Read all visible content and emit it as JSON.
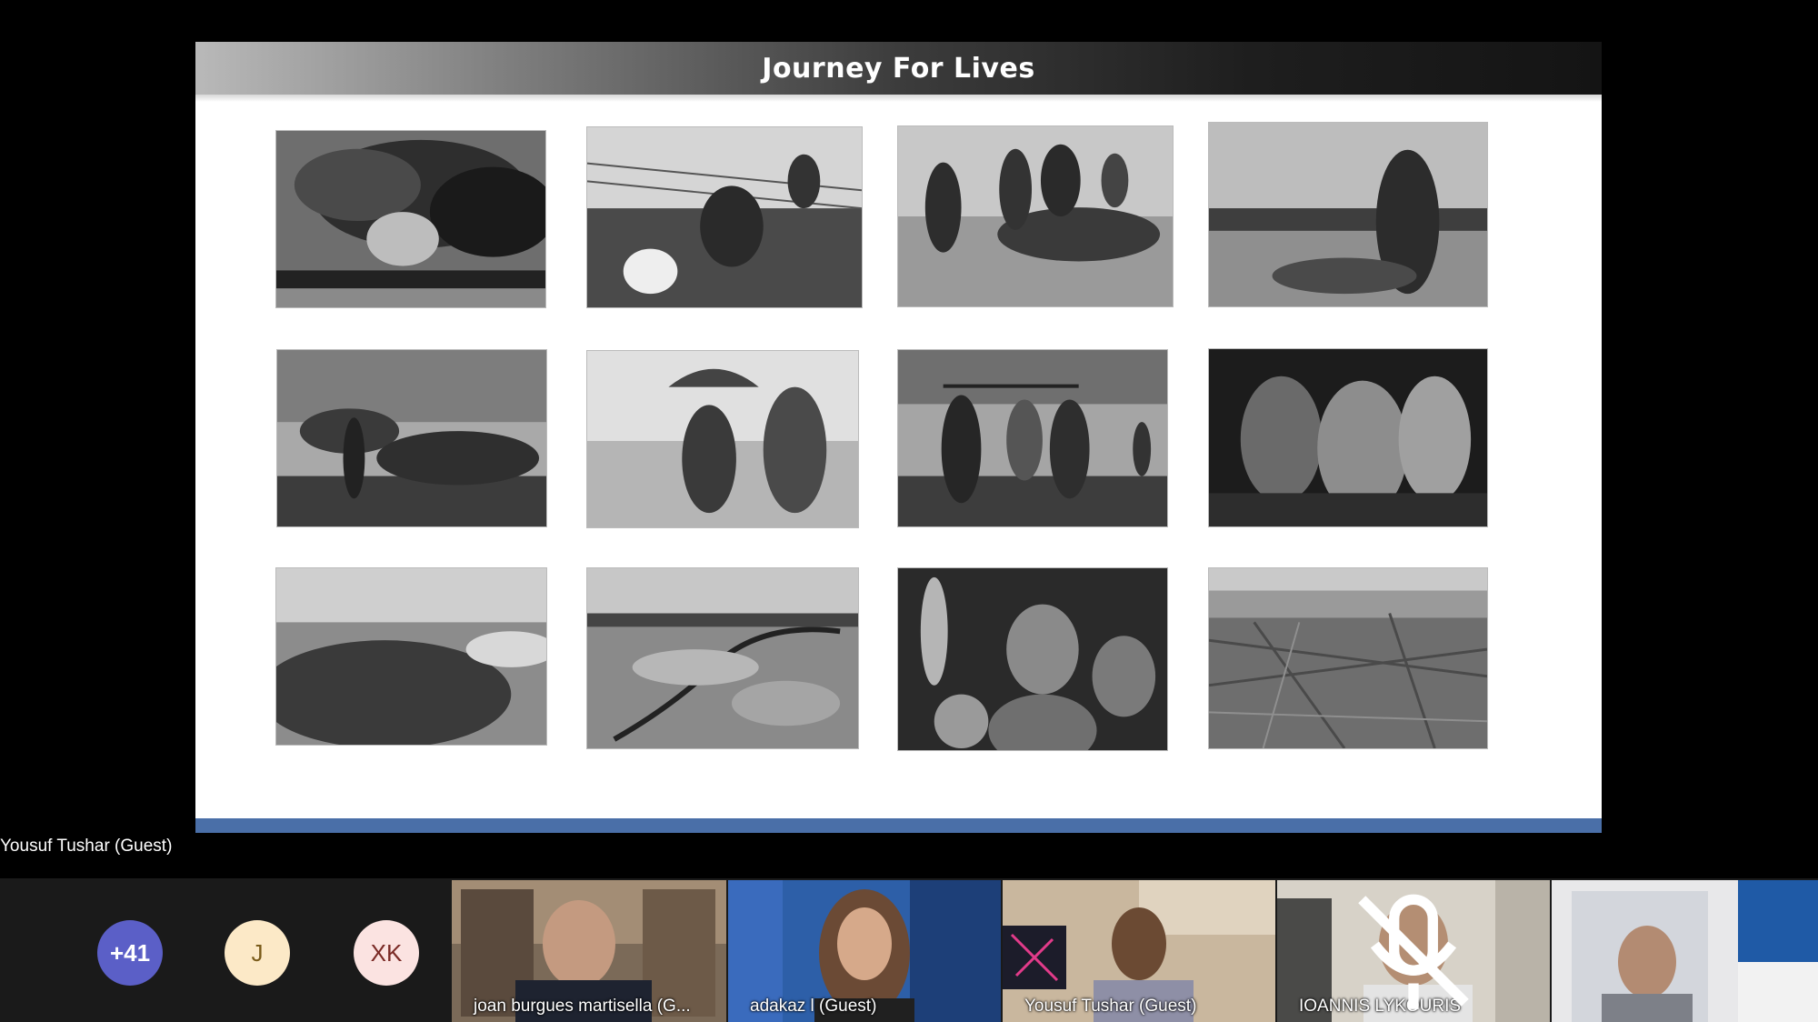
{
  "slide": {
    "title": "Journey For Lives",
    "footer_bar_color": "#4a6fa8"
  },
  "speaker": {
    "name": "Yousuf Tushar (Guest)"
  },
  "participants_strip": {
    "overflow_count": "+41",
    "avatars": [
      {
        "initials": "J",
        "color": "#fce9c7",
        "text_color": "#7a5b1a"
      },
      {
        "initials": "XK",
        "color": "#fbe3e1",
        "text_color": "#7a2a25"
      }
    ],
    "overflow_color": "#5b5fc7",
    "tiles": [
      {
        "label": "joan burgues martisella (G..."
      },
      {
        "label": "adakaz l (Guest)"
      },
      {
        "label": "Yousuf Tushar (Guest)"
      },
      {
        "label": "IOANNIS LYKOURIS"
      },
      {
        "label": ""
      }
    ]
  }
}
